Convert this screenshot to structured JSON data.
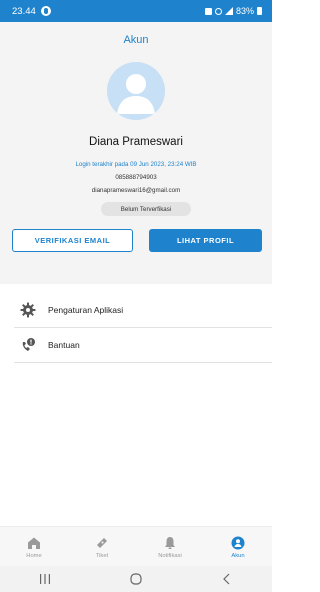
{
  "status_bar": {
    "time": "23.44",
    "battery": "83%",
    "icons": [
      "notification-icon",
      "silent-icon",
      "mute-icon",
      "signal-icon",
      "battery-icon"
    ]
  },
  "header": {
    "title": "Akun",
    "user_name": "Diana Prameswari",
    "last_login": "Login terakhir pada 09 Jun 2023, 23:24 WIB",
    "phone": "085888794903",
    "email": "dianaprameswari16@gmail.com",
    "verification_status": "Belum Terverfikasi"
  },
  "buttons": {
    "verify_email": "VERIFIKASI EMAIL",
    "view_profile": "LIHAT PROFIL"
  },
  "menu": [
    {
      "label": "Pengaturan Aplikasi",
      "icon": "gear-icon"
    },
    {
      "label": "Bantuan",
      "icon": "help-phone-icon"
    }
  ],
  "bottom_nav": [
    {
      "label": "Home",
      "icon": "home-icon",
      "active": false
    },
    {
      "label": "Tiket",
      "icon": "ticket-icon",
      "active": false
    },
    {
      "label": "Notifikasi",
      "icon": "bell-icon",
      "active": false
    },
    {
      "label": "Akun",
      "icon": "account-icon",
      "active": true
    }
  ],
  "colors": {
    "primary": "#1e83cc",
    "header_bg": "#f4f4f4",
    "avatar_bg": "#c7e0f5",
    "inactive": "#9a9a9a"
  }
}
